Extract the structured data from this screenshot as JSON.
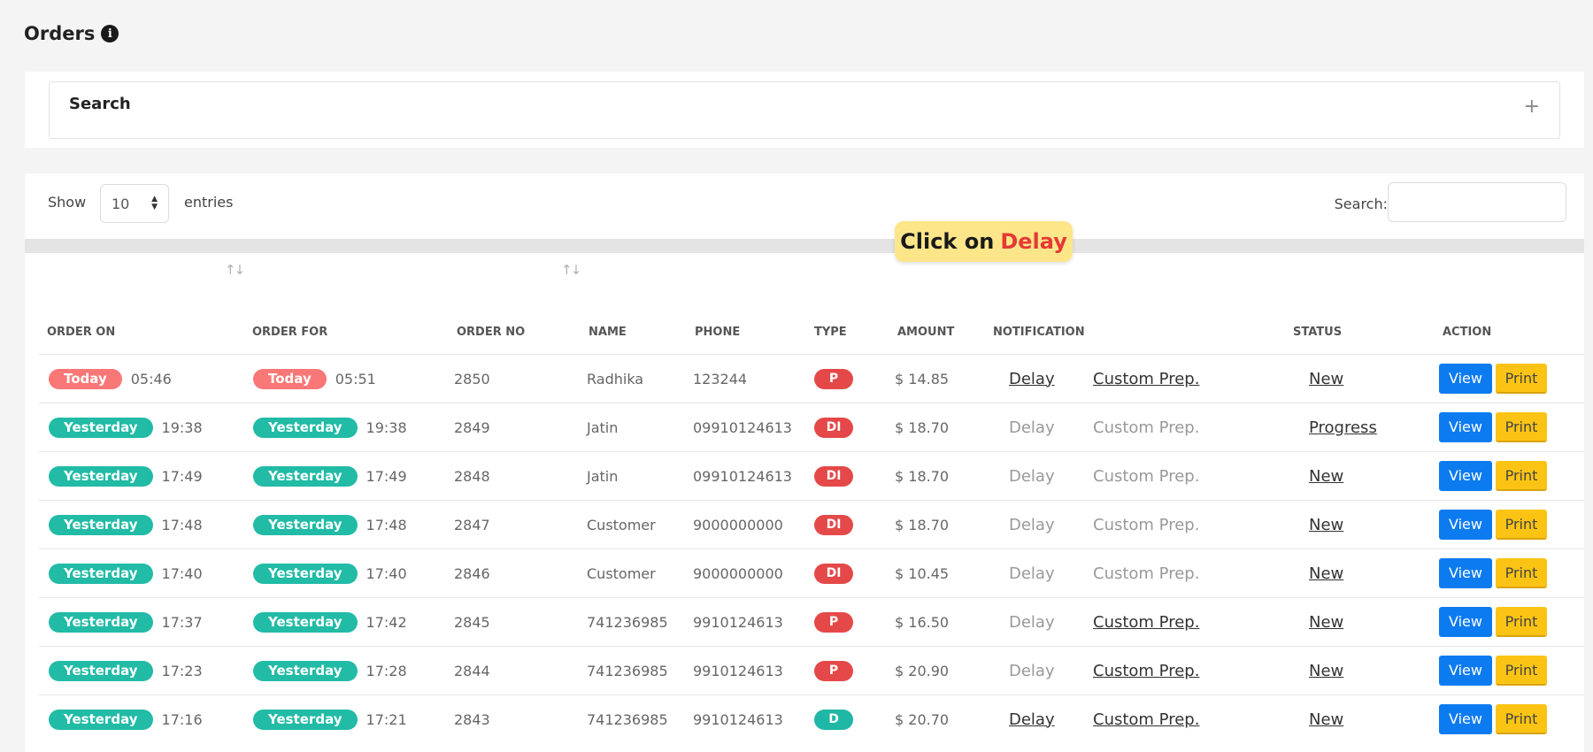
{
  "page": {
    "title": "Orders"
  },
  "search_panel": {
    "title": "Search",
    "expand_symbol": "+"
  },
  "toolbar": {
    "show_label": "Show",
    "entries_value": "10",
    "entries_label": "entries",
    "search_label": "Search:"
  },
  "tooltip": {
    "prefix": "Click on",
    "highlight": "Delay"
  },
  "table": {
    "headers": {
      "order_on": "ORDER ON",
      "order_for": "ORDER FOR",
      "order_no": "ORDER NO",
      "name": "NAME",
      "phone": "PHONE",
      "type": "TYPE",
      "amount": "AMOUNT",
      "notification": "NOTIFICATION",
      "status": "STATUS",
      "action": "ACTION"
    },
    "rows": [
      {
        "on_day": "Today",
        "on_time": "05:46",
        "for_day": "Today",
        "for_time": "05:51",
        "order_no": "2850",
        "name": "Radhika",
        "phone": "123244",
        "type": "P",
        "amount": "$ 14.85",
        "delay": "Delay",
        "custom": "Custom Prep.",
        "status": "New",
        "view": "View",
        "print": "Print"
      },
      {
        "on_day": "Yesterday",
        "on_time": "19:38",
        "for_day": "Yesterday",
        "for_time": "19:38",
        "order_no": "2849",
        "name": "Jatin",
        "phone": "09910124613",
        "type": "DI",
        "amount": "$ 18.70",
        "delay": "Delay",
        "custom": "Custom Prep.",
        "status": "Progress",
        "view": "View",
        "print": "Print"
      },
      {
        "on_day": "Yesterday",
        "on_time": "17:49",
        "for_day": "Yesterday",
        "for_time": "17:49",
        "order_no": "2848",
        "name": "Jatin",
        "phone": "09910124613",
        "type": "DI",
        "amount": "$ 18.70",
        "delay": "Delay",
        "custom": "Custom Prep.",
        "status": "New",
        "view": "View",
        "print": "Print"
      },
      {
        "on_day": "Yesterday",
        "on_time": "17:48",
        "for_day": "Yesterday",
        "for_time": "17:48",
        "order_no": "2847",
        "name": "Customer",
        "phone": "9000000000",
        "type": "DI",
        "amount": "$ 18.70",
        "delay": "Delay",
        "custom": "Custom Prep.",
        "status": "New",
        "view": "View",
        "print": "Print"
      },
      {
        "on_day": "Yesterday",
        "on_time": "17:40",
        "for_day": "Yesterday",
        "for_time": "17:40",
        "order_no": "2846",
        "name": "Customer",
        "phone": "9000000000",
        "type": "DI",
        "amount": "$ 10.45",
        "delay": "Delay",
        "custom": "Custom Prep.",
        "status": "New",
        "view": "View",
        "print": "Print"
      },
      {
        "on_day": "Yesterday",
        "on_time": "17:37",
        "for_day": "Yesterday",
        "for_time": "17:42",
        "order_no": "2845",
        "name": "741236985",
        "phone": "9910124613",
        "type": "P",
        "amount": "$ 16.50",
        "delay": "Delay",
        "custom": "Custom Prep.",
        "status": "New",
        "view": "View",
        "print": "Print"
      },
      {
        "on_day": "Yesterday",
        "on_time": "17:23",
        "for_day": "Yesterday",
        "for_time": "17:28",
        "order_no": "2844",
        "name": "741236985",
        "phone": "9910124613",
        "type": "P",
        "amount": "$ 20.90",
        "delay": "Delay",
        "custom": "Custom Prep.",
        "status": "New",
        "view": "View",
        "print": "Print"
      },
      {
        "on_day": "Yesterday",
        "on_time": "17:16",
        "for_day": "Yesterday",
        "for_time": "17:21",
        "order_no": "2843",
        "name": "741236985",
        "phone": "9910124613",
        "type": "D",
        "amount": "$ 20.70",
        "delay": "Delay",
        "custom": "Custom Prep.",
        "status": "New",
        "view": "View",
        "print": "Print"
      }
    ]
  },
  "colors": {
    "today_pill": "#f97777",
    "yesterday_pill": "#21bba6",
    "type_red": "#e54848",
    "type_teal": "#1fb7a5",
    "view_button": "#0d7bf0",
    "print_button": "#fbc414",
    "tooltip_bg": "#fde68a",
    "tooltip_highlight": "#e53935"
  },
  "icons": {
    "title_info": "info-icon",
    "search_expand": "plus-icon",
    "sort": "sort-icon",
    "select": "select-arrows-icon"
  }
}
